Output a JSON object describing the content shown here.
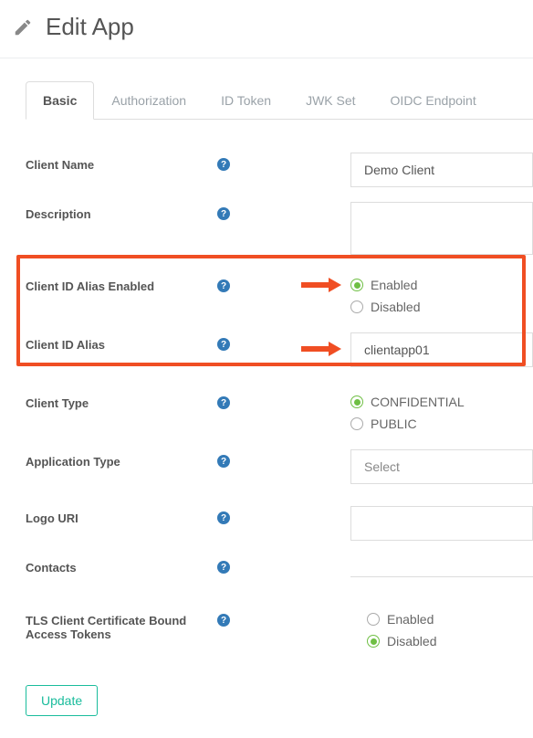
{
  "header": {
    "title": "Edit App"
  },
  "tabs": [
    "Basic",
    "Authorization",
    "ID Token",
    "JWK Set",
    "OIDC Endpoint"
  ],
  "activeTab": 0,
  "fields": {
    "clientName": {
      "label": "Client Name",
      "value": "Demo Client"
    },
    "description": {
      "label": "Description",
      "value": ""
    },
    "clientIdAliasEnabled": {
      "label": "Client ID Alias Enabled",
      "options": [
        "Enabled",
        "Disabled"
      ],
      "selected": "Enabled"
    },
    "clientIdAlias": {
      "label": "Client ID Alias",
      "value": "clientapp01"
    },
    "clientType": {
      "label": "Client Type",
      "options": [
        "CONFIDENTIAL",
        "PUBLIC"
      ],
      "selected": "CONFIDENTIAL"
    },
    "applicationType": {
      "label": "Application Type",
      "placeholder": "Select"
    },
    "logoUri": {
      "label": "Logo URI",
      "value": ""
    },
    "contacts": {
      "label": "Contacts",
      "value": ""
    },
    "tlsBound": {
      "label": "TLS Client Certificate Bound Access Tokens",
      "options": [
        "Enabled",
        "Disabled"
      ],
      "selected": "Disabled"
    }
  },
  "buttons": {
    "update": "Update"
  }
}
